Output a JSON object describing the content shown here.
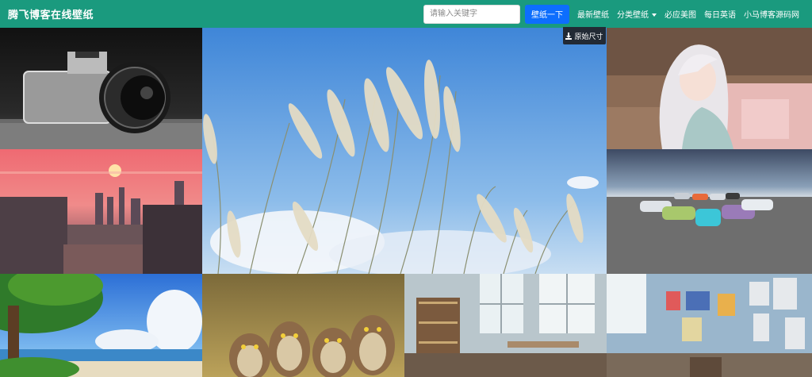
{
  "brand": {
    "title": "腾飞博客在线壁纸"
  },
  "search": {
    "placeholder": "请输入关键字",
    "button_label": "壁纸一下"
  },
  "nav": {
    "items": [
      "最新壁纸",
      "分类壁纸",
      "必应美图",
      "每日英语",
      "小马博客源码网"
    ]
  },
  "overlay": {
    "download_label": "原始尺寸"
  },
  "colors": {
    "navbar": "#1a9a7e",
    "search_button": "#0d6efd",
    "badge": "#222a35"
  },
  "wallpapers": [
    {
      "name": "camera-photo"
    },
    {
      "name": "reeds-sky-photo"
    },
    {
      "name": "anime-girl-photo"
    },
    {
      "name": "sunset-city-photo"
    },
    {
      "name": "cars-beach-photo"
    },
    {
      "name": "tree-ocean-photo"
    },
    {
      "name": "owls-photo"
    },
    {
      "name": "room-photo"
    },
    {
      "name": "poster-room-photo"
    }
  ]
}
